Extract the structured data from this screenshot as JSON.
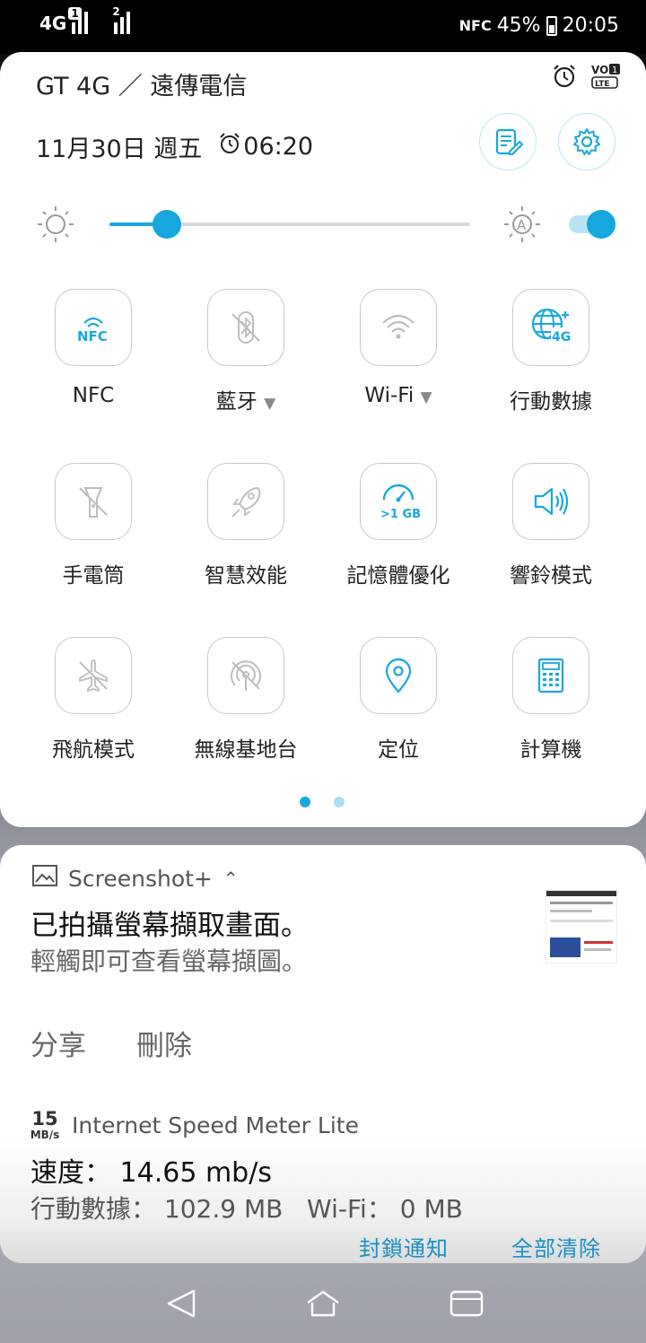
{
  "status_bar": {
    "network": "4G",
    "sim1_badge": "1",
    "sim2_badge": "2",
    "nfc": "NFC",
    "battery": "45%",
    "time": "20:05"
  },
  "quick_settings": {
    "carrier": "GT 4G ／ 遠傳電信",
    "date": "11月30日 週五",
    "alarm": "06:20",
    "brightness_level": 0.16,
    "auto_brightness_on": true,
    "tiles": [
      {
        "label": "NFC",
        "icon": "nfc-icon",
        "active": true,
        "dropdown": false
      },
      {
        "label": "藍牙",
        "icon": "bluetooth-off-icon",
        "active": false,
        "dropdown": true
      },
      {
        "label": "Wi-Fi",
        "icon": "wifi-icon",
        "active": false,
        "dropdown": true
      },
      {
        "label": "行動數據",
        "icon": "mobile-data-icon",
        "active": true,
        "dropdown": false
      },
      {
        "label": "手電筒",
        "icon": "flashlight-off-icon",
        "active": false,
        "dropdown": false
      },
      {
        "label": "智慧效能",
        "icon": "rocket-icon",
        "active": false,
        "dropdown": false
      },
      {
        "label": "記憶體優化",
        "icon": "memory-boost-icon",
        "active": true,
        "dropdown": false
      },
      {
        "label": "響鈴模式",
        "icon": "sound-icon",
        "active": true,
        "dropdown": false
      },
      {
        "label": "飛航模式",
        "icon": "airplane-off-icon",
        "active": false,
        "dropdown": false
      },
      {
        "label": "無線基地台",
        "icon": "hotspot-off-icon",
        "active": false,
        "dropdown": false
      },
      {
        "label": "定位",
        "icon": "location-icon",
        "active": true,
        "dropdown": false
      },
      {
        "label": "計算機",
        "icon": "calculator-icon",
        "active": true,
        "dropdown": false
      }
    ],
    "memory_tile_text": ">1 GB",
    "mobile_tile_text": "4G"
  },
  "notifications": {
    "screenshot": {
      "app": "Screenshot+",
      "title": "已拍攝螢幕擷取畫面。",
      "body": "輕觸即可查看螢幕擷圖。",
      "action_share": "分享",
      "action_delete": "刪除"
    },
    "speed_meter": {
      "icon_value": "15",
      "icon_unit": "MB/s",
      "app": "Internet Speed Meter Lite",
      "title": "速度： 14.65 mb/s",
      "body": "行動數據： 102.9 MB   Wi-Fi： 0 MB"
    },
    "footer_left": "封鎖通知",
    "footer_right": "全部清除"
  },
  "colors": {
    "accent": "#16a8dd",
    "inactive_icon": "#bdbdbd"
  }
}
